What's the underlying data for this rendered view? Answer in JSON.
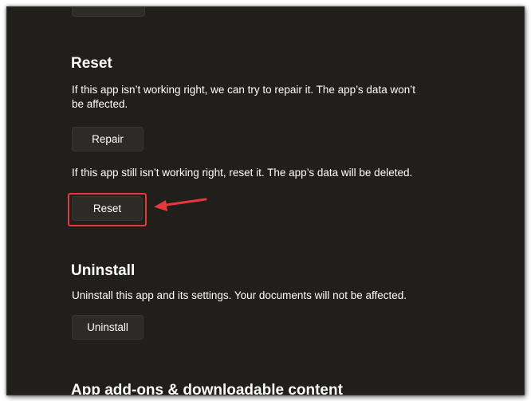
{
  "reset": {
    "heading": "Reset",
    "repair_description": "If this app isn’t working right, we can try to repair it. The app’s data won’t be affected.",
    "repair_button": "Repair",
    "reset_description": "If this app still isn’t working right, reset it. The app’s data will be deleted.",
    "reset_button": "Reset"
  },
  "uninstall": {
    "heading": "Uninstall",
    "description": "Uninstall this app and its settings. Your documents will not be affected.",
    "button": "Uninstall"
  },
  "addons": {
    "heading": "App add-ons & downloadable content"
  },
  "annotation": {
    "highlight_color": "#e5383b",
    "arrow_icon": "arrow-left-icon"
  }
}
